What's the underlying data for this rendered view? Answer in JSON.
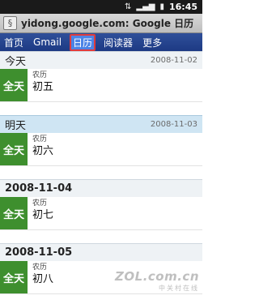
{
  "status": {
    "time": "16:45",
    "icons": [
      "usb-icon",
      "signal-icon",
      "battery-icon"
    ]
  },
  "browser": {
    "url_text": "yidong.google.com: Google 日历"
  },
  "nav": {
    "tabs": [
      {
        "label": "首页"
      },
      {
        "label": "Gmail"
      },
      {
        "label": "日历"
      },
      {
        "label": "阅读器"
      },
      {
        "label": "更多"
      }
    ],
    "active_index": 2
  },
  "agenda": {
    "days": [
      {
        "label": "今天",
        "date": "2008-11-02",
        "event": {
          "allday": "全天",
          "sub": "农历",
          "title": "初五"
        }
      },
      {
        "label": "明天",
        "date": "2008-11-03",
        "event": {
          "allday": "全天",
          "sub": "农历",
          "title": "初六"
        }
      },
      {
        "label": "2008-11-04",
        "date": "",
        "event": {
          "allday": "全天",
          "sub": "农历",
          "title": "初七"
        }
      },
      {
        "label": "2008-11-05",
        "date": "",
        "event": {
          "allday": "全天",
          "sub": "农历",
          "title": "初八"
        }
      }
    ]
  },
  "watermark": {
    "logo": "ZOL.com.cn",
    "sub": "中关村在线"
  },
  "colors": {
    "nav_bg": "#1d3a84",
    "active_tab": "#4c84e6",
    "allday_green": "#3e8f2e",
    "header_blue": "#cfe5f3"
  }
}
